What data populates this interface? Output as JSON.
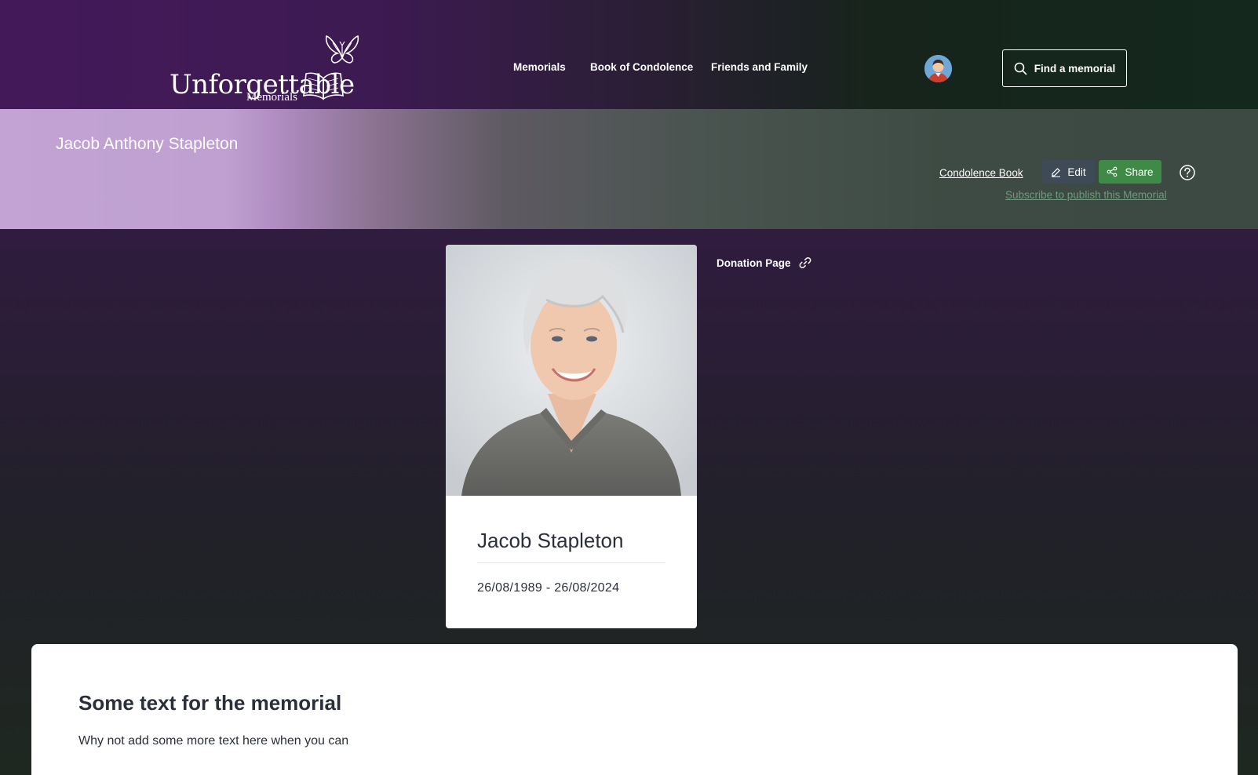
{
  "header": {
    "logo": {
      "word": "Unforgettable",
      "sub": "Memorials"
    },
    "nav": [
      {
        "label": "Memorials"
      },
      {
        "label": "Book of Condolence"
      },
      {
        "label": "Friends and Family"
      }
    ],
    "find_button": {
      "label": "Find a memorial",
      "icon": "search-icon"
    },
    "avatar_icon": "user-avatar"
  },
  "banner": {
    "title": "Jacob Anthony Stapleton",
    "condolence_link": "Condolence Book",
    "edit_label": "Edit",
    "share_label": "Share",
    "subscribe_link": "Subscribe to publish this Memorial",
    "help_icon": "question-circle-icon"
  },
  "profile": {
    "name": "Jacob Stapleton",
    "dates": "26/08/1989 - 26/08/2024"
  },
  "donation": {
    "label": "Donation Page",
    "icon": "link-icon"
  },
  "memorial_text": {
    "heading": "Some text for the memorial",
    "body": "Why not add some more text here when you can"
  },
  "colors": {
    "header_purple": "#44195a",
    "header_green": "#14281d",
    "banner_lilac": "#c2a3d4",
    "share_green": "#3f8a46",
    "edit_slate": "#3e4a56",
    "subscribe_green": "#6f9a7e",
    "text_dark": "#2a2f3a"
  }
}
